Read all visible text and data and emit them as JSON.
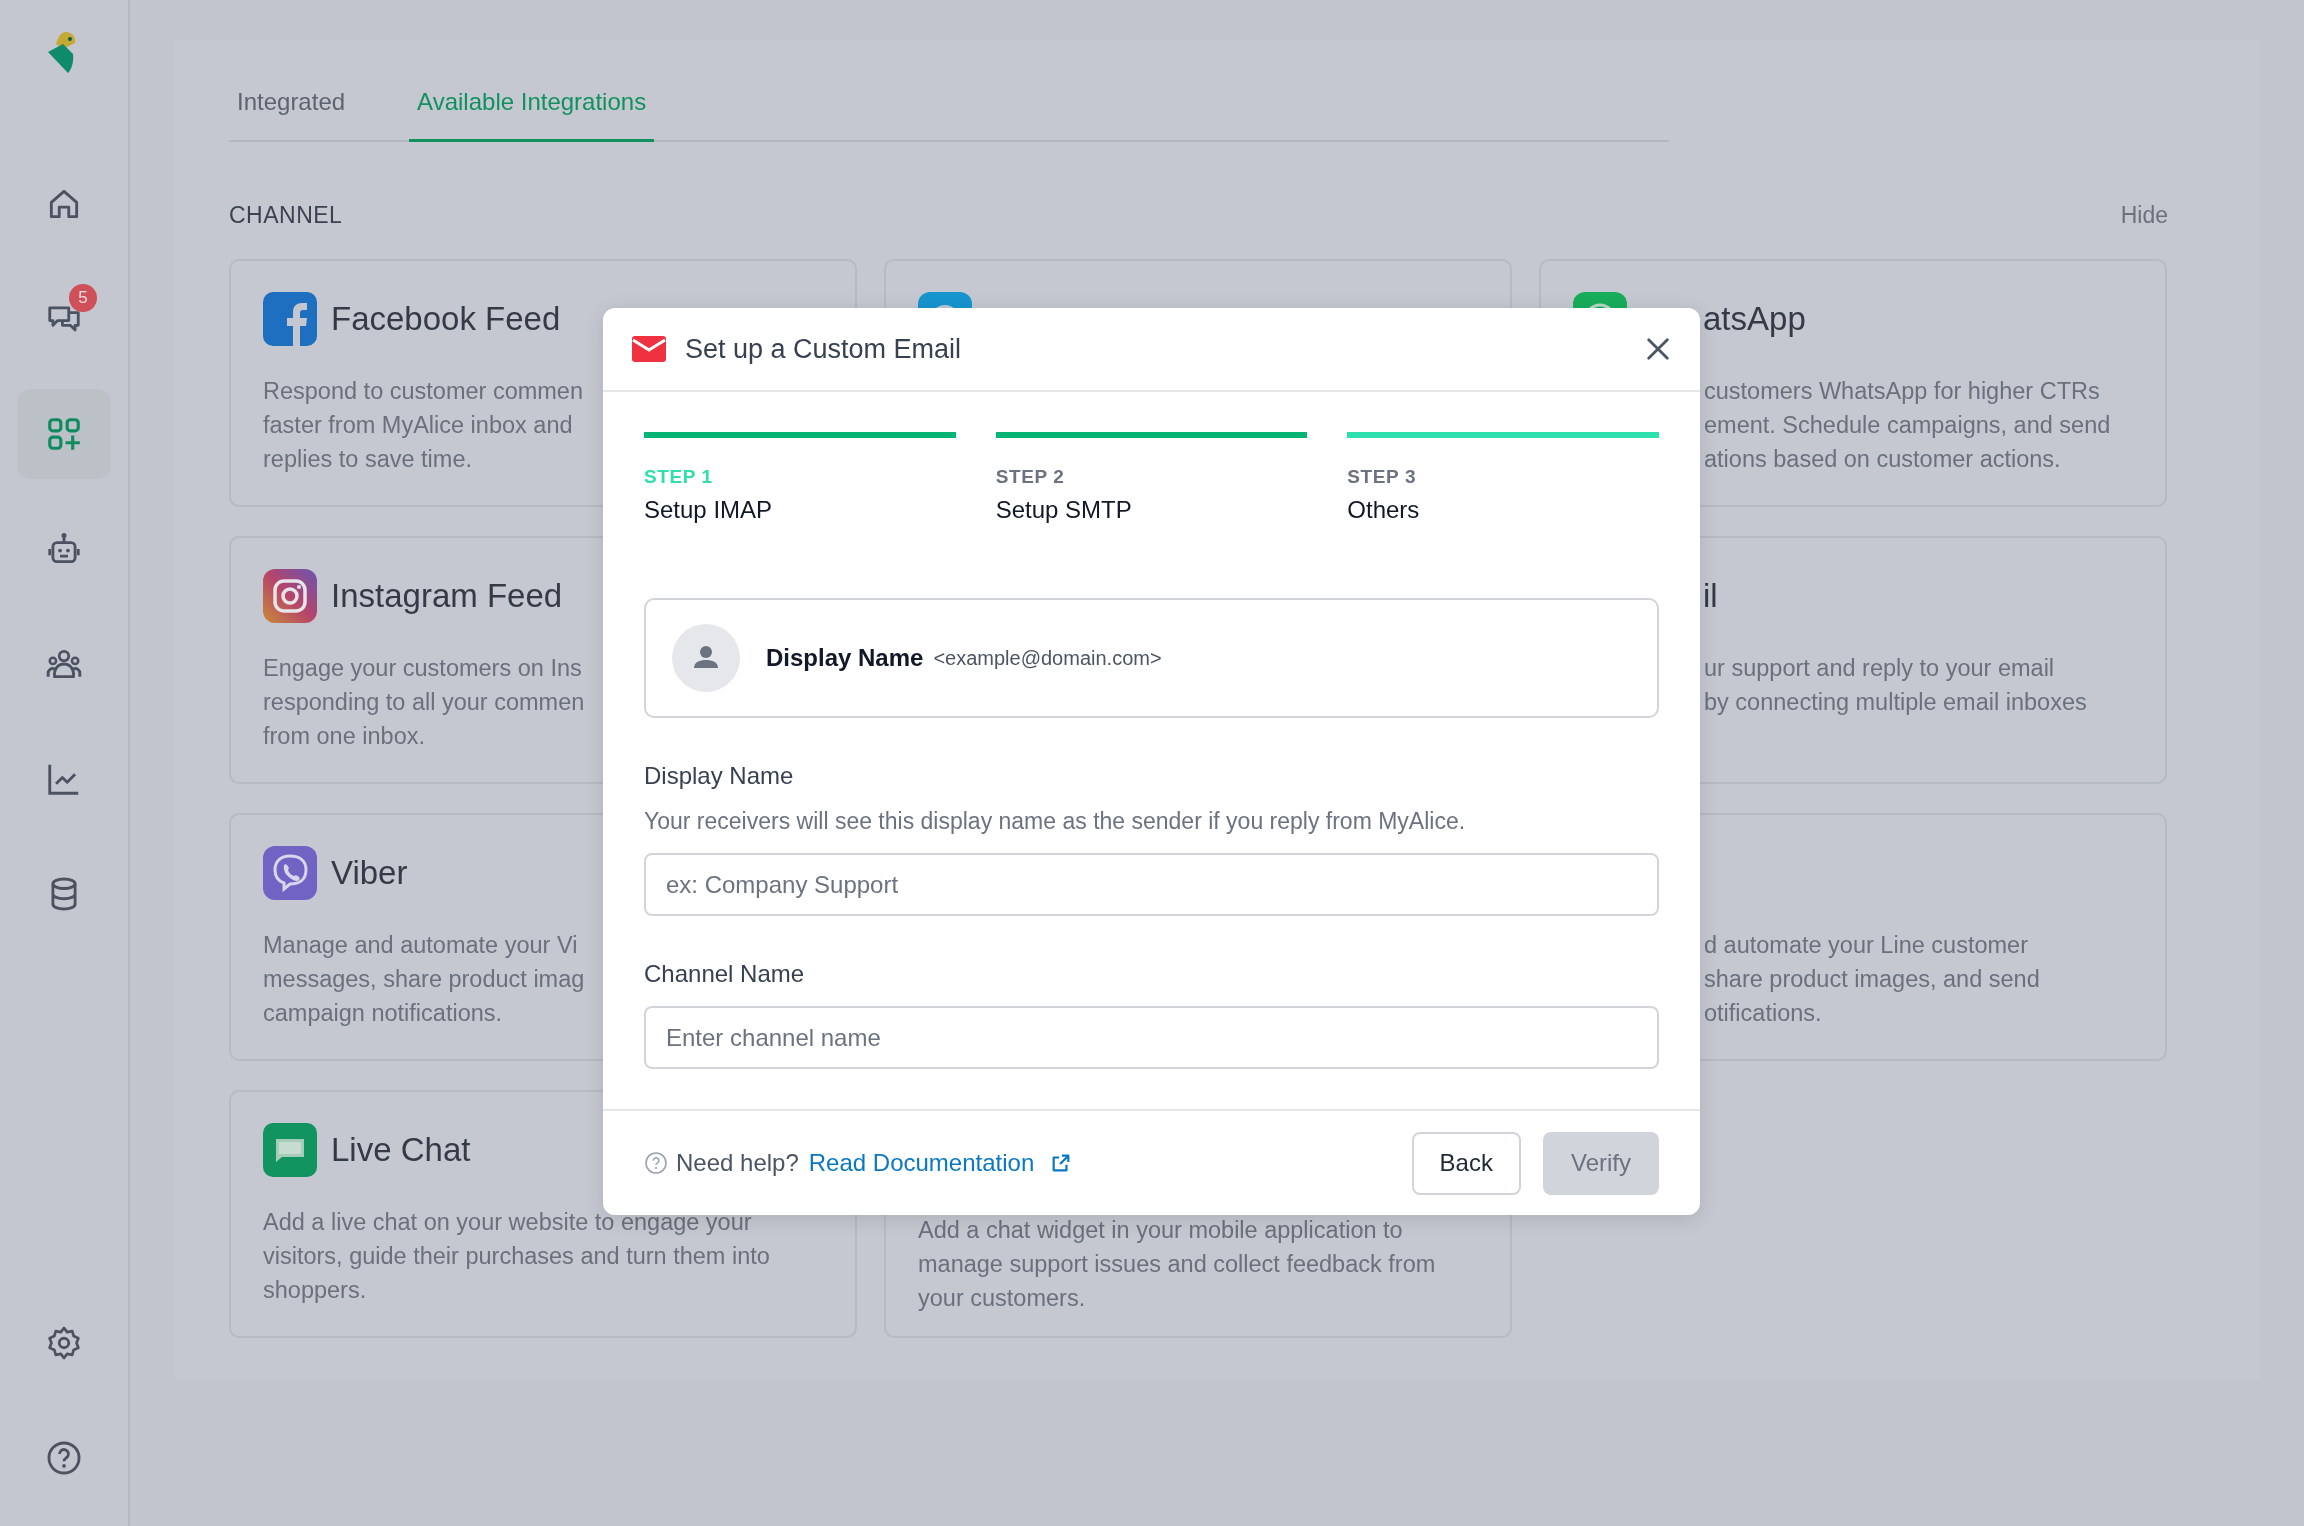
{
  "sidebar": {
    "items": [
      {
        "kind": "home",
        "selected": false
      },
      {
        "kind": "chat",
        "selected": false,
        "badge": "5"
      },
      {
        "kind": "apps",
        "selected": true
      },
      {
        "kind": "bot",
        "selected": false
      },
      {
        "kind": "team",
        "selected": false
      },
      {
        "kind": "chart",
        "selected": false
      },
      {
        "kind": "database",
        "selected": false
      }
    ],
    "bottom_items": [
      {
        "kind": "settings",
        "selected": false
      },
      {
        "kind": "help",
        "selected": false
      }
    ]
  },
  "tabs": [
    {
      "label": "Integrated",
      "selected": false
    },
    {
      "label": "Available Integrations",
      "selected": true
    }
  ],
  "section": {
    "title": "CHANNEL",
    "action": "Hide"
  },
  "card_columns": [
    [
      {
        "kind": "facebook",
        "title": "Facebook Feed",
        "lines": [
          "Respond to customer commen",
          "faster from MyAlice inbox and",
          "replies to save time."
        ]
      },
      {
        "kind": "instagram",
        "title": "Instagram Feed",
        "lines": [
          "Engage your customers on Ins",
          "responding to all your commen",
          "from one inbox."
        ]
      },
      {
        "kind": "viber",
        "title": "Viber",
        "lines": [
          "Manage and automate your Vi",
          "messages, share product imag",
          "campaign notifications."
        ]
      },
      {
        "kind": "livechat",
        "title": "Live Chat",
        "lines": [
          "Add a live chat on your website to engage your",
          "visitors, guide their purchases and turn them into",
          "shoppers."
        ]
      }
    ],
    [
      {
        "kind": "messenger"
      },
      {
        "lines": [
          "Add a chat widget in your mobile application to",
          "manage support issues and collect feedback from",
          "your customers."
        ]
      }
    ],
    [
      {
        "kind": "whatsapp",
        "title": "atsApp",
        "lines": [
          "customers WhatsApp for higher CTRs",
          "ement. Schedule campaigns, and send",
          "ations based on customer actions."
        ]
      },
      {
        "title": "il",
        "lines": [
          "ur support and reply to your email",
          "by connecting multiple email inboxes"
        ]
      },
      {
        "lines": [
          "d automate your Line customer",
          "share product images, and send",
          "otifications."
        ]
      }
    ]
  ],
  "modal": {
    "title": "Set up a Custom Email",
    "steps": [
      {
        "label": "STEP 1",
        "title": "Setup IMAP",
        "selected": true,
        "complete": true
      },
      {
        "label": "STEP 2",
        "title": "Setup SMTP",
        "selected": false,
        "complete": true
      },
      {
        "label": "STEP 3",
        "title": "Others",
        "selected": false,
        "complete": false
      }
    ],
    "preview": {
      "name": "Display Name",
      "email": "<example@domain.com>"
    },
    "fields": [
      {
        "label": "Display Name",
        "help": "Your receivers will see this display name as the sender if you reply from MyAlice.",
        "placeholder": "ex: Company Support"
      },
      {
        "label": "Channel Name",
        "placeholder": "Enter channel name"
      }
    ],
    "footer": {
      "help": "Need help?",
      "link": "Read Documentation"
    },
    "buttons": [
      {
        "label": "Back",
        "kind": "secondary",
        "disabled": false
      },
      {
        "label": "Verify",
        "kind": "primary",
        "disabled": true
      }
    ]
  }
}
